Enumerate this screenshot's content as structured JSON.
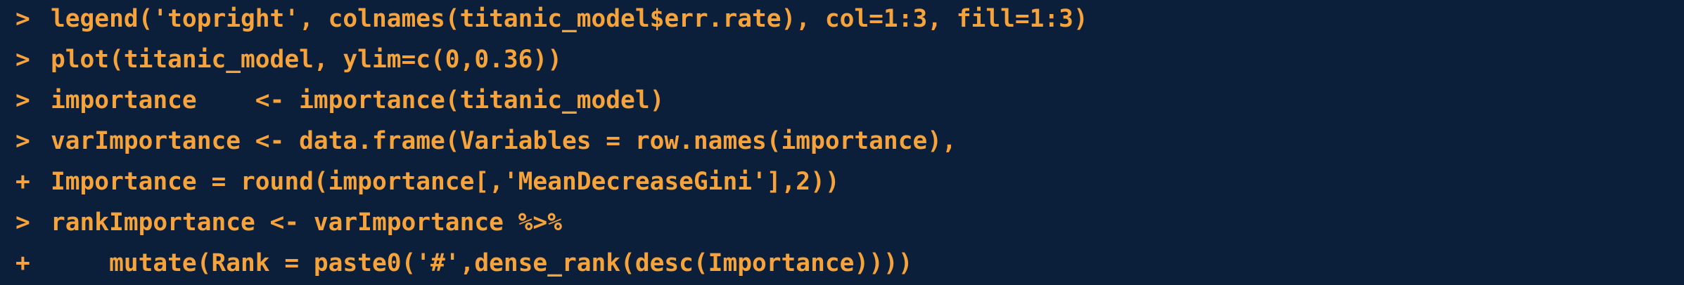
{
  "console": {
    "lines": [
      {
        "prompt": ">",
        "code": "legend('topright', colnames(titanic_model$err.rate), col=1:3, fill=1:3)"
      },
      {
        "prompt": ">",
        "code": "plot(titanic_model, ylim=c(0,0.36))"
      },
      {
        "prompt": ">",
        "code": "importance    <- importance(titanic_model)"
      },
      {
        "prompt": ">",
        "code": "varImportance <- data.frame(Variables = row.names(importance),"
      },
      {
        "prompt": "+",
        "code": "Importance = round(importance[,'MeanDecreaseGini'],2))"
      },
      {
        "prompt": ">",
        "code": "rankImportance <- varImportance %>%"
      },
      {
        "prompt": "+",
        "code": "    mutate(Rank = paste0('#',dense_rank(desc(Importance))))"
      }
    ]
  },
  "colors": {
    "background": "#0b1f3a",
    "text": "#f5a33a"
  }
}
